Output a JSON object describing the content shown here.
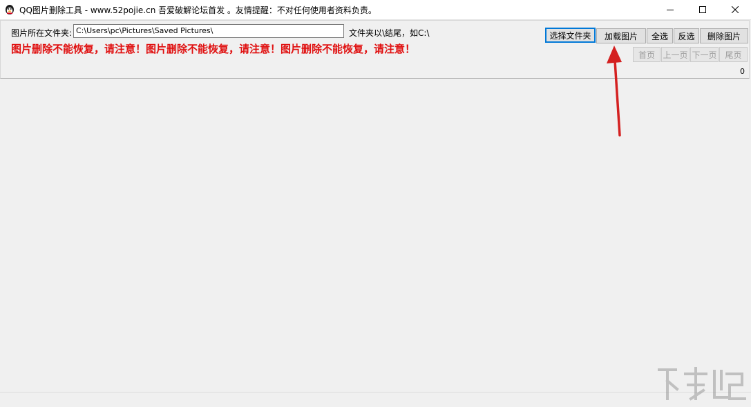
{
  "window": {
    "title": "QQ图片删除工具 - www.52pojie.cn 吾爱破解论坛首发 。友情提醒：不对任何使用者资料负责。"
  },
  "form": {
    "folder_label": "图片所在文件夹:",
    "folder_value": "C:\\Users\\pc\\Pictures\\Saved Pictures\\",
    "hint": "文件夹以\\结尾，如C:\\",
    "warning": "图片删除不能恢复，请注意！图片删除不能恢复，请注意！图片删除不能恢复，请注意！"
  },
  "toolbar": {
    "select_folder": "选择文件夹",
    "load_images": "加载图片",
    "select_all": "全选",
    "invert": "反选",
    "delete_images": "删除图片"
  },
  "pager": {
    "first": "首页",
    "prev": "上一页",
    "next": "下一页",
    "last": "尾页",
    "count": "0"
  },
  "colors": {
    "warning": "#e01010",
    "annotation_arrow": "#d42020",
    "focus_border": "#0078d7"
  },
  "icons": [
    "app-icon",
    "minimize-icon",
    "maximize-icon",
    "close-icon"
  ]
}
